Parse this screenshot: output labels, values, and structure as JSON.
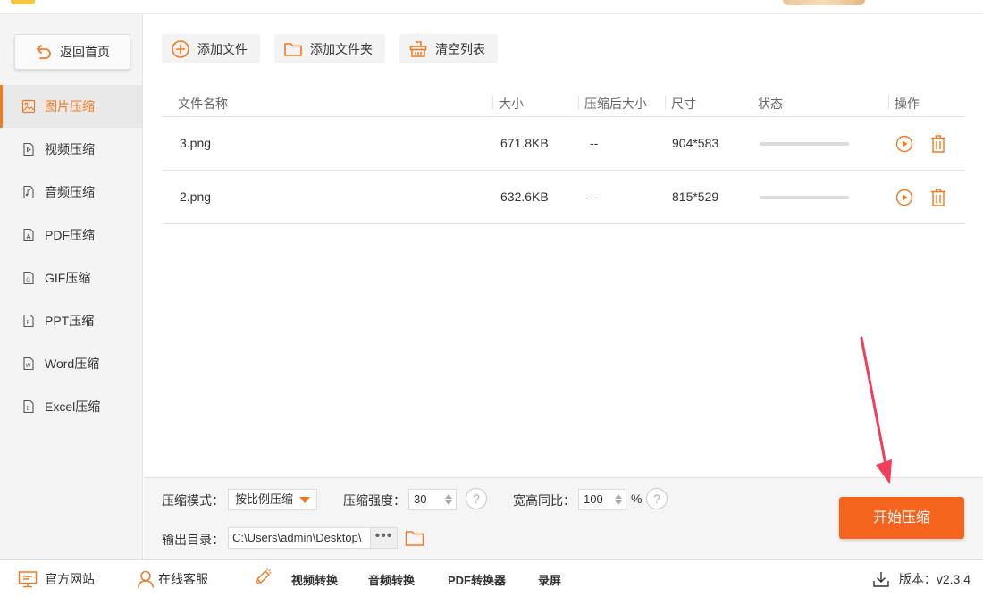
{
  "sidebar": {
    "back_label": "返回首页",
    "items": [
      {
        "label": "图片压缩",
        "icon": "image-icon",
        "active": true
      },
      {
        "label": "视频压缩",
        "icon": "video-icon",
        "active": false
      },
      {
        "label": "音频压缩",
        "icon": "audio-icon",
        "active": false
      },
      {
        "label": "PDF压缩",
        "icon": "pdf-icon",
        "active": false
      },
      {
        "label": "GIF压缩",
        "icon": "gif-icon",
        "active": false
      },
      {
        "label": "PPT压缩",
        "icon": "ppt-icon",
        "active": false
      },
      {
        "label": "Word压缩",
        "icon": "word-icon",
        "active": false
      },
      {
        "label": "Excel压缩",
        "icon": "excel-icon",
        "active": false
      }
    ]
  },
  "toolbar": {
    "add_file": "添加文件",
    "add_folder": "添加文件夹",
    "clear_list": "清空列表"
  },
  "table": {
    "headers": {
      "name": "文件名称",
      "size": "大小",
      "compressed_size": "压缩后大小",
      "dimensions": "尺寸",
      "status": "状态",
      "actions": "操作"
    },
    "rows": [
      {
        "name": "3.png",
        "size": "671.8KB",
        "compressed_size": "--",
        "dimensions": "904*583",
        "progress": 0
      },
      {
        "name": "2.png",
        "size": "632.6KB",
        "compressed_size": "--",
        "dimensions": "815*529",
        "progress": 0
      }
    ]
  },
  "settings": {
    "mode_label": "压缩模式：",
    "mode_value": "按比例压缩",
    "strength_label": "压缩强度：",
    "strength_value": "30",
    "ratio_label": "宽高同比：",
    "ratio_value": "100",
    "ratio_unit": "%",
    "help_glyph": "?",
    "output_label": "输出目录：",
    "output_path": "C:\\Users\\admin\\Desktop\\",
    "browse_glyph": "•••",
    "start_button": "开始压缩"
  },
  "bottombar": {
    "website": "官方网站",
    "support": "在线客服",
    "video_convert": "视频转换",
    "audio_convert": "音频转换",
    "pdf_convert": "PDF转换器",
    "record": "录屏",
    "version_label": "版本：",
    "version_value": "v2.3.4"
  },
  "colors": {
    "accent": "#f07a22",
    "start_button": "#f5631c",
    "annotation_arrow": "#f23d5b"
  }
}
